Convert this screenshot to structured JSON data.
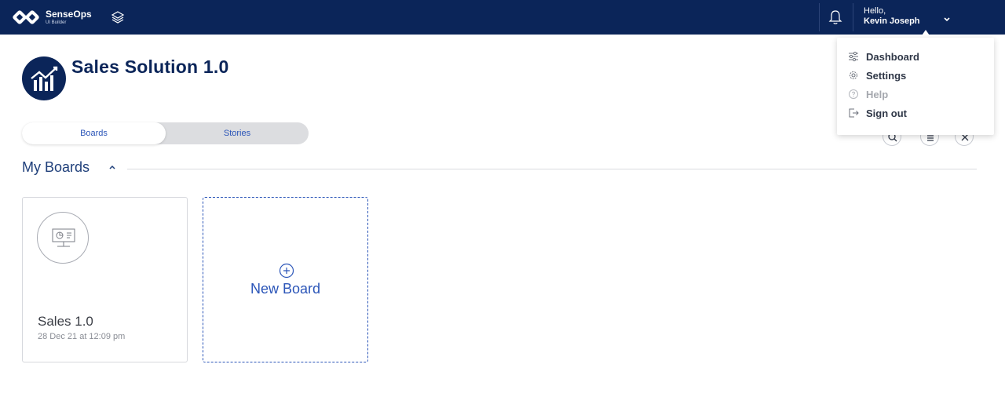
{
  "header": {
    "brand_name": "SenseOps",
    "brand_sub": "UI Builder",
    "greeting": "Hello,",
    "user_name": "Kevin Joseph",
    "icons": [
      "infinity-logo-icon",
      "layers-icon",
      "bell-icon",
      "chevron-down-icon"
    ]
  },
  "app": {
    "title": "Sales Solution 1.0",
    "logo_icon": "chart-logo-icon"
  },
  "tabs": [
    {
      "label": "Boards",
      "active": true
    },
    {
      "label": "Stories",
      "active": false
    }
  ],
  "section": {
    "title": "My Boards",
    "toggle_icon": "chevron-up-icon"
  },
  "toolbar": {
    "icons": [
      "search-icon",
      "list-icon",
      "tools-icon"
    ]
  },
  "boards": [
    {
      "name": "Sales 1.0",
      "date": "28 Dec 21 at 12:09 pm",
      "icon": "board-presentation-icon"
    }
  ],
  "new_board": {
    "label": "New Board",
    "icon": "plus-circle-icon"
  },
  "user_menu": {
    "items": [
      {
        "label": "Dashboard",
        "icon": "sliders-icon",
        "enabled": true
      },
      {
        "label": "Settings",
        "icon": "gear-icon",
        "enabled": true
      },
      {
        "label": "Help",
        "icon": "help-icon",
        "enabled": false
      },
      {
        "label": "Sign out",
        "icon": "sign-out-icon",
        "enabled": true
      }
    ]
  },
  "colors": {
    "navy": "#0b2559",
    "accent": "#2b55b8",
    "tab_track": "#dcdde0"
  }
}
